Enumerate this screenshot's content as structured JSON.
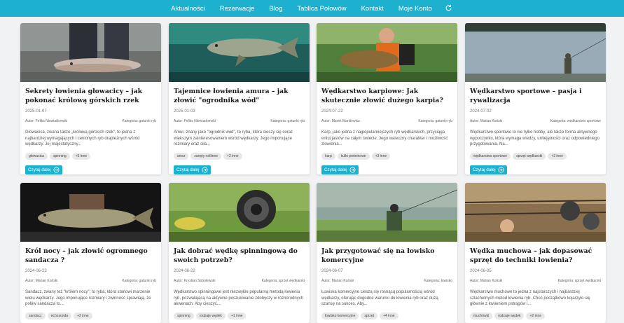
{
  "nav": {
    "items": [
      "Aktualności",
      "Rezerwacje",
      "Blog",
      "Tablica Połowów",
      "Kontakt",
      "Moje Konto"
    ]
  },
  "read_more_label": "Czytaj dalej",
  "colors": {
    "accent": "#1db0cf",
    "card_bg": "#ffffff",
    "page_bg": "#f1f2f3"
  },
  "posts": [
    {
      "title": "Sekrety łowienia głowacicy – jak pokonać królową górskich rzek",
      "date": "2025-01-07",
      "author": "Autor: Feliks Niewiadomski",
      "category": "Kategoria: gatunki ryb",
      "excerpt": "Głowacica, zwana także „królową górskich rzek\", to jedna z najbardziej wymagających i cenionych ryb drapieżnych wśród wędkarzy. Jej majestatyczny...",
      "tags": [
        "głowacica",
        "spinning",
        "+5 inne"
      ],
      "image": "huchen-fish-photo"
    },
    {
      "title": "Tajemnice łowienia amura – jak złowić \"ogrodnika wód\"",
      "date": "2025-01-03",
      "author": "Autor: Feliks Niewiadomski",
      "category": "Kategoria: gatunki ryb",
      "excerpt": "Amur, znany jako \"ogrodnik wód\", to ryba, która cieszy się coraz większym zainteresowaniem wśród wędkarzy. Jego imponujące rozmiary oraz siła...",
      "tags": [
        "amur",
        "zanęty roślinne",
        "+2 inne"
      ],
      "image": "grass-carp-underwater-photo"
    },
    {
      "title": "Wędkarstwo karpiowe: Jak skutecznie złowić dużego karpia?",
      "date": "2024-07-22",
      "author": "Autor: Marek Markiewicz",
      "category": "Kategoria: gatunki ryb",
      "excerpt": "Karp, jako jedna z najpopularniejszych ryb wędkarskich, przyciąga entuzjastów na całym świecie. Jego waleczny charakter i możliwość złowienia...",
      "tags": [
        "karp",
        "kulki proteinowe",
        "+3 inne"
      ],
      "image": "angler-holding-carp-photo"
    },
    {
      "title": "Wędkarstwo sportowe – pasja i rywalizacja",
      "date": "2024-07-02",
      "author": "Autor: Marian Koński",
      "category": "Kategoria: wędkarstwo sportowe",
      "excerpt": "Wędkarstwo sportowe to nie tylko hobby, ale także forma aktywnego wypoczynku, która wymaga wiedzy, umiejętności oraz odpowiedniego przygotowania. Na...",
      "tags": [
        "wędkarstwo sportowe",
        "sprzęt wędkarski",
        "+3 inne"
      ],
      "image": "angler-on-lake-photo"
    },
    {
      "title": "Król nocy – jak złowić ogromnego sandacza ?",
      "date": "2024-06-23",
      "author": "Autor: Marian Koński",
      "category": "Kategoria: gatunki ryb",
      "excerpt": "Sandacz, zwany też \"królem nocy\", to ryba, która stanowi marzenie wielu wędkarzy. Jego imponujące rozmiary i zwinność sprawiają, że połów sandacza to...",
      "tags": [
        "sandacz",
        "echosonda",
        "+2 inne"
      ],
      "image": "zander-fish-photo"
    },
    {
      "title": "Jak dobrać wędkę spinningową do swoich potrzeb?",
      "date": "2024-06-22",
      "author": "Autor: Krystian Sobolewski",
      "category": "Kategoria: sprzęt wędkarski",
      "excerpt": "Wędkarstwo spinningowe jest niezwykle popularną metodą łowienia ryb, pozwalającą na aktywne poszukiwanie zdobyczy w różnorodnych akwenach. Aby cieszyć...",
      "tags": [
        "spinning",
        "rodzaje wędek",
        "+1 inne"
      ],
      "image": "spinning-reel-lure-photo"
    },
    {
      "title": "Jak przygotować się na łowisko komercyjne",
      "date": "2024-06-07",
      "author": "Autor: Marian Koński",
      "category": "Kategoria: łowisko",
      "excerpt": "Łowiska komercyjne cieszą się rosnącą popularnością wśród wędkarzy, oferując dogodne warunki do łowienia ryb oraz dużą szansę na sukces. Aby...",
      "tags": [
        "łowisko komercyjne",
        "sprzęt",
        "+4 inne"
      ],
      "image": "angler-sitting-bank-photo"
    },
    {
      "title": "Wędka muchowa – jak dopasować sprzęt do techniki łowienia?",
      "date": "2024-06-05",
      "author": "Autor: Marian Koński",
      "category": "Kategoria: sprzęt wędkarski",
      "excerpt": "Wędkarstwo muchowe to jedna z najstarszych i najbardziej szlachetnych metod łowienia ryb. Choć początkowo kojarzyło się głównie z łowieniem pstrągów i...",
      "tags": [
        "muchówki",
        "rodzaje wędek",
        "+2 inne"
      ],
      "image": "fly-rods-reels-photo"
    }
  ]
}
